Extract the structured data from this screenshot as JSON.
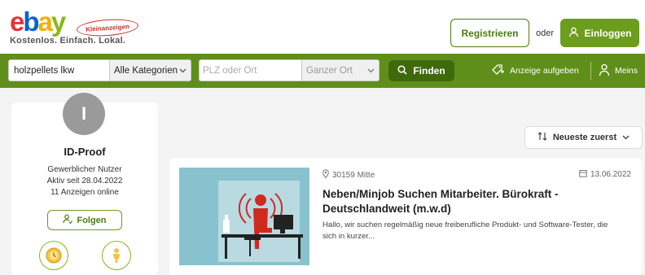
{
  "brand": {
    "logo_text": [
      "e",
      "b",
      "a",
      "y"
    ],
    "badge": "Kleinanzeigen",
    "tagline": "Kostenlos. Einfach. Lokal.",
    "colors": {
      "accent_green": "#6c9d1c",
      "bar_green": "#5f8f1a",
      "dark_green": "#3f6a0c"
    }
  },
  "header": {
    "register_label": "Registrieren",
    "or_label": "oder",
    "login_label": "Einloggen",
    "login_icon": "user-icon"
  },
  "search": {
    "query": "holzpellets lkw",
    "category": "Alle Kategorien",
    "location_placeholder": "PLZ oder Ort",
    "radius": "Ganzer Ort",
    "find_label": "Finden",
    "find_icon": "search-icon",
    "post_ad_label": "Anzeige aufgeben",
    "post_ad_icon": "add-tag-icon",
    "my_label": "Meins",
    "my_icon": "user-icon"
  },
  "profile": {
    "avatar_initial": "I",
    "name": "ID-Proof",
    "type": "Gewerblicher Nutzer",
    "active_since": "Aktiv seit 28.04.2022",
    "ads_online": "11 Anzeigen online",
    "follow_label": "Folgen",
    "follow_icon": "follow-user-icon",
    "badges": [
      "badge-clock-icon",
      "badge-person-icon"
    ]
  },
  "sort": {
    "label": "Neueste zuerst",
    "icon": "sort-icon"
  },
  "listings": [
    {
      "location": "30159 Mitte",
      "date": "13.06.2022",
      "title": "Neben/Minjob Suchen Mitarbeiter. Bürokraft - Deutschlandweit (m.w.d)",
      "description": "Hallo, wir suchen regelmäßig neue freiberufliche Produkt- und Software-Tester, die sich in kurzer..."
    }
  ]
}
